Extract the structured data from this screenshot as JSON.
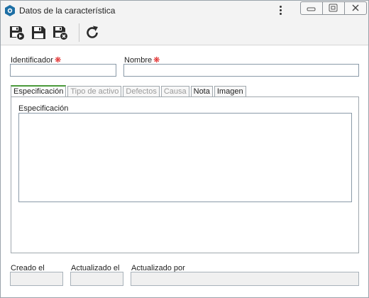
{
  "window": {
    "title": "Datos de la característica"
  },
  "toolbar": {
    "buttons": [
      {
        "icon": "save-and-new-icon"
      },
      {
        "icon": "save-icon"
      },
      {
        "icon": "save-and-close-icon"
      },
      {
        "icon": "refresh-icon"
      }
    ]
  },
  "form": {
    "identificador_label": "Identificador",
    "nombre_label": "Nombre",
    "required_mark": "❋",
    "identificador_value": "",
    "nombre_value": ""
  },
  "tabs": [
    {
      "label": "Especificación",
      "state": "active"
    },
    {
      "label": "Tipo de activo",
      "state": "disabled"
    },
    {
      "label": "Defectos",
      "state": "disabled"
    },
    {
      "label": "Causa",
      "state": "disabled"
    },
    {
      "label": "Nota",
      "state": "enabled"
    },
    {
      "label": "Imagen",
      "state": "enabled"
    }
  ],
  "panel": {
    "especificacion_label": "Especificación",
    "especificacion_value": ""
  },
  "footer": {
    "creado_label": "Creado el",
    "actualizado_label": "Actualizado el",
    "actualizado_por_label": "Actualizado por",
    "creado_value": "",
    "actualizado_value": "",
    "actualizado_por_value": ""
  },
  "colors": {
    "active_tab_accent": "#4a9a3a",
    "required": "#dd1111",
    "app_icon": "#1d6fa5"
  }
}
